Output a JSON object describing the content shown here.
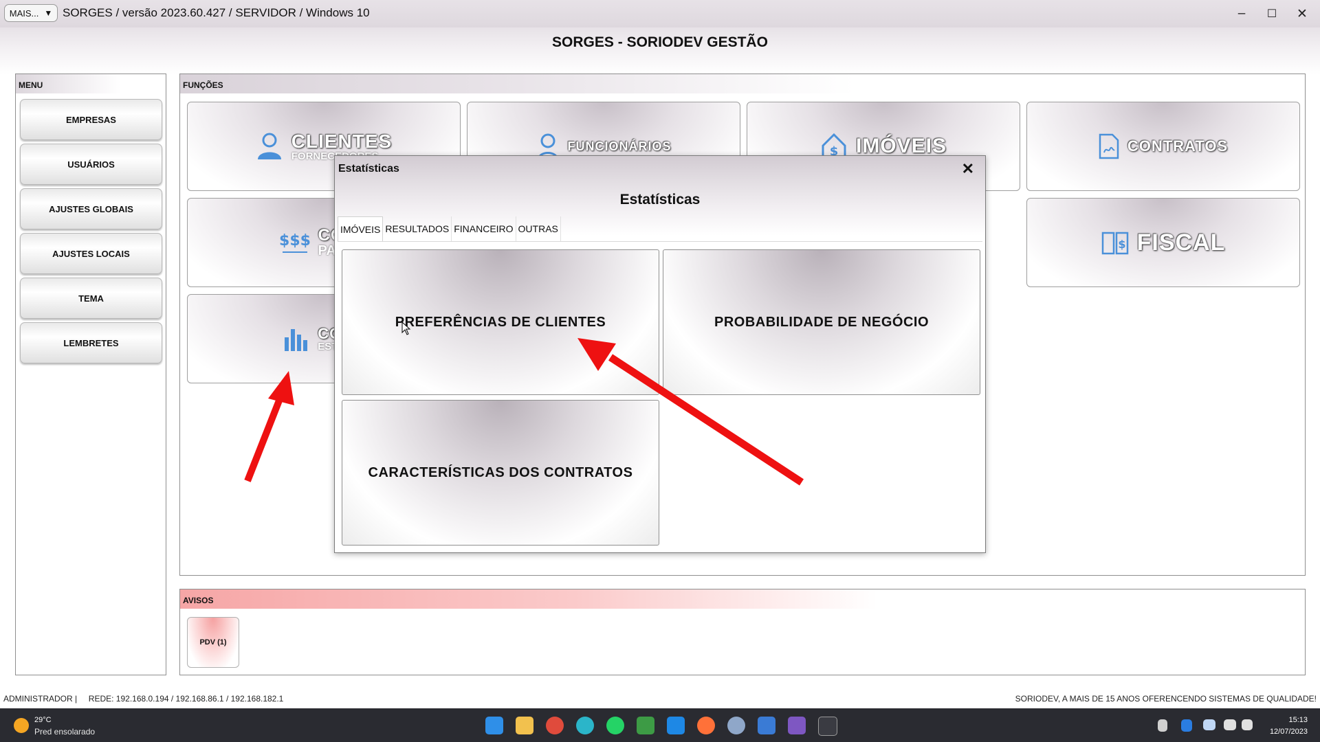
{
  "window": {
    "mais_label": "MAIS...",
    "mais_caret": "▼",
    "title": "SORGES / versão 2023.60.427 / SERVIDOR / Windows 10",
    "minimize_glyph": "–",
    "maximize_glyph": "☐",
    "close_glyph": "✕"
  },
  "header": {
    "title": "SORGES - SORIODEV GESTÃO"
  },
  "menu": {
    "title": "MENU",
    "items": [
      "EMPRESAS",
      "USUÁRIOS",
      "AJUSTES GLOBAIS",
      "AJUSTES LOCAIS",
      "TEMA",
      "LEMBRETES"
    ]
  },
  "functions": {
    "title": "FUNÇÕES",
    "tiles": [
      {
        "label": "CLIENTES",
        "sub": "FORNECEDORES",
        "icon": "person-icon"
      },
      {
        "label": "FUNCIONÁRIOS",
        "sub": "",
        "icon": "employee-icon"
      },
      {
        "label": "IMÓVEIS",
        "sub": "",
        "icon": "house-dollar-icon"
      },
      {
        "label": "CONTRATOS",
        "sub": "",
        "icon": "contract-icon"
      },
      {
        "label": "CONT",
        "sub": "PAGAM",
        "icon": "money-icon"
      },
      {
        "label": "FISCAL",
        "sub": "",
        "icon": "fiscal-book-icon"
      },
      {
        "label": "CONS",
        "sub": "ESTAT",
        "icon": "bar-chart-icon"
      }
    ]
  },
  "avisos": {
    "title": "AVISOS",
    "pdv_label": "PDV (1)"
  },
  "status": {
    "left": "ADMINISTRADOR |     REDE: 192.168.0.194 / 192.168.86.1 / 192.168.182.1",
    "right": "SORIODEV, A MAIS DE 15 ANOS OFERENCENDO SISTEMAS DE QUALIDADE!"
  },
  "modal": {
    "title": "Estatísticas",
    "close_glyph": "✕",
    "heading": "Estatísticas",
    "tabs": [
      "IMÓVEIS",
      "RESULTADOS",
      "FINANCEIRO",
      "OUTRAS"
    ],
    "active_tab": "IMÓVEIS",
    "tiles": [
      "PREFERÊNCIAS DE CLIENTES",
      "PROBABILIDADE DE NEGÓCIO",
      "CARACTERÍSTICAS DOS CONTRATOS"
    ]
  },
  "taskbar": {
    "weather_temp": "29°C",
    "weather_desc": "Pred ensolarado",
    "time": "15:13",
    "date": "12/07/2023"
  },
  "colors": {
    "annotation_arrow": "#ee1111",
    "tile_label_blue": "#4a90d9",
    "avisos_accent": "#f6a6a6"
  }
}
